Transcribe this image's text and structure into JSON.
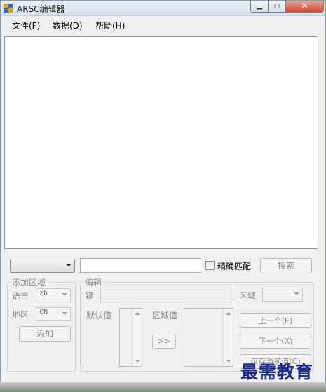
{
  "window": {
    "title": "ARSC编辑器",
    "minimize_icon": "minimize-icon",
    "maximize_icon": "maximize-icon",
    "close_icon": "close-icon"
  },
  "menu": {
    "file": "文件(F)",
    "data": "数据(D)",
    "help": "帮助(H)"
  },
  "search_bar": {
    "search_field_value": "",
    "exact_match_label": "精确匹配",
    "exact_match_checked": false,
    "search_button": "搜索"
  },
  "add_region": {
    "group_title": "添加区域",
    "language_label": "语言",
    "language_value": "zh",
    "region_label": "地区",
    "region_value": "CN",
    "add_button": "添加"
  },
  "edit": {
    "group_title": "编辑",
    "key_label": "键",
    "key_value": "",
    "region_label": "区域",
    "default_value_label": "默认值",
    "copy_button": ">>",
    "region_value_label": "区域值",
    "prev_button": "上一个(E)",
    "next_button": "下一个(X)",
    "save_button": "仅存当前值(C)"
  },
  "watermark": "最需教育",
  "colors": {
    "disabled_text": "#8d8d8d",
    "watermark": "#1a2b8c",
    "close_button": "#c44a2f"
  }
}
